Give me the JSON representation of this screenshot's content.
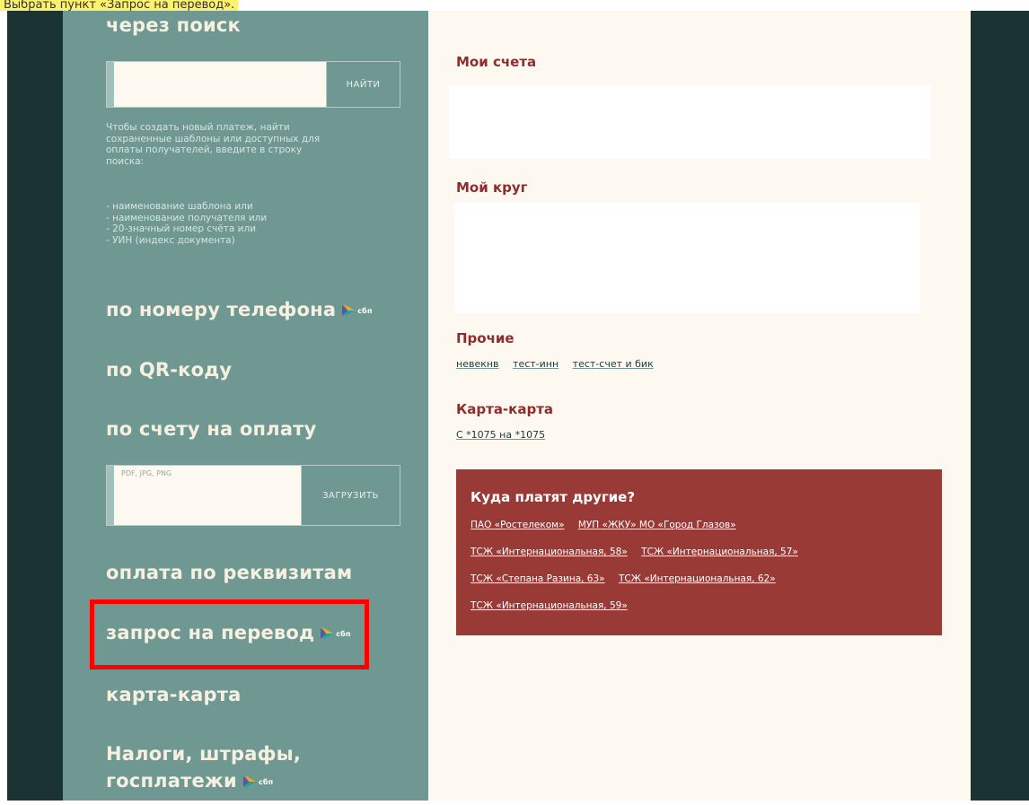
{
  "caption": "Выбрать пункт «Запрос на перевод».",
  "sidebar": {
    "search_heading": "через поиск",
    "search_button": "НАЙТИ",
    "search_hint_lines": [
      "Чтобы создать новый платеж, найти",
      "сохраненные шаблоны или доступных для",
      "оплаты получателей, введите в строку",
      "поиска:"
    ],
    "search_hint_list": [
      "- наименование шаблона или",
      "- наименование получателя или",
      "- 20-значный номер счёта или",
      "- УИН (индекс документа)"
    ],
    "by_phone": "по номеру телефона",
    "by_qr": "по QR-коду",
    "by_invoice": "по счету на оплату",
    "upload_placeholder": "PDF, JPG, PNG",
    "upload_button": "ЗАГРУЗИТЬ",
    "by_requisites": "оплата по реквизитам",
    "transfer_request": "запрос на перевод",
    "card_to_card": "карта-карта",
    "taxes_line1": "Налоги, штрафы,",
    "taxes_line2": "госплатежи",
    "sbp_label": "сбп"
  },
  "content": {
    "my_accounts_title": "Мои счета",
    "my_circle_title": "Мой круг",
    "other_title": "Прочие",
    "other_links": [
      "невекнв",
      "тест-инн",
      "тест-счет и бик"
    ],
    "card_title": "Карта-карта",
    "card_links": [
      "С *1075 на *1075"
    ],
    "others_pay": {
      "title": "Куда платят другие?",
      "row1": [
        "ПАО «Ростелеком»",
        "МУП «ЖКУ» МО «Город Глазов»"
      ],
      "row2": [
        "ТСЖ «Интернациональная, 58»",
        "ТСЖ «Интернациональная, 57»"
      ],
      "row3": [
        "ТСЖ «Степана Разина, 63»",
        "ТСЖ «Интернациональная, 62»"
      ],
      "row4": [
        "ТСЖ «Интернациональная, 59»"
      ]
    }
  },
  "colors": {
    "sidebar_bg": "#6e9891",
    "content_bg": "#fdf9f1",
    "accent_red": "#9a3a37",
    "title_red": "#8e2d2d",
    "highlight": "#ff0000",
    "caption_bg": "#fdf26b"
  }
}
